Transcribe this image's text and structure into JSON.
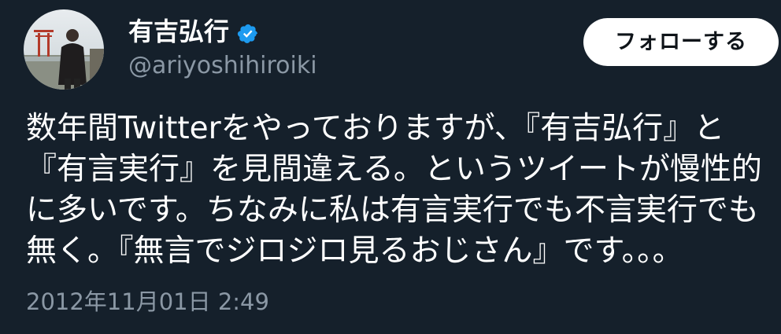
{
  "author": {
    "name": "有吉弘行",
    "handle": "@ariyoshihiroiki",
    "verified": true,
    "verified_icon": "verified-badge-icon",
    "verified_color": "#1d9bf0"
  },
  "follow_button": {
    "label": "フォローする"
  },
  "tweet": {
    "lines": [
      "数年間Twitterをやっておりますが、『有吉弘行』と",
      "『有言実行』を見間違える。というツイートが慢性的",
      "に多いです。ちなみに私は有言実行でも不言実行でも",
      "無く。『無言でジロジロ見るおじさん』です。。。"
    ],
    "timestamp": "2012年11月01日 2:49"
  },
  "colors": {
    "background": "#15202b",
    "text": "#ffffff",
    "secondary_text": "#8b98a5",
    "button_bg": "#ffffff",
    "button_text": "#0f1419"
  }
}
